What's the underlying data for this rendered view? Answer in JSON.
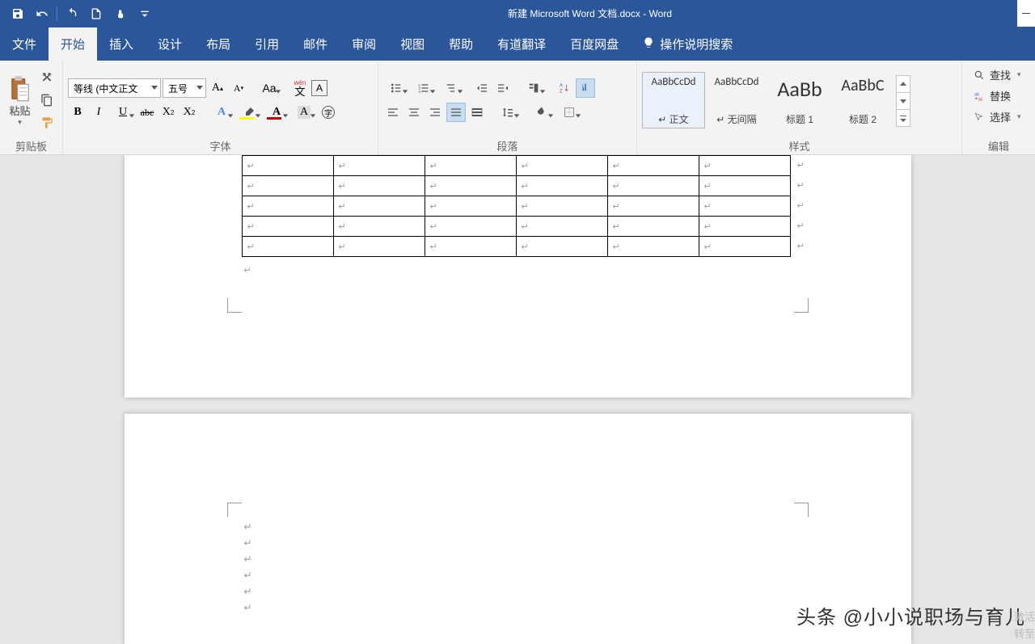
{
  "title": "新建 Microsoft Word 文档.docx - Word",
  "tabs": {
    "file": "文件",
    "home": "开始",
    "insert": "插入",
    "design": "设计",
    "layout": "布局",
    "references": "引用",
    "mail": "邮件",
    "review": "审阅",
    "view": "视图",
    "help": "帮助",
    "youdao": "有道翻译",
    "baidu": "百度网盘",
    "tell": "操作说明搜索"
  },
  "groups": {
    "clipboard": "剪贴板",
    "font": "字体",
    "paragraph": "段落",
    "styles": "样式",
    "editing": "编辑",
    "paste": "粘贴"
  },
  "font": {
    "name": "等线 (中文正文",
    "size": "五号",
    "wen": "wén",
    "aa": "Aa",
    "a_char": "A"
  },
  "styles": {
    "normal": {
      "preview": "AaBbCcDd",
      "name": "↵ 正文"
    },
    "nospace": {
      "preview": "AaBbCcDd",
      "name": "↵ 无间隔"
    },
    "h1": {
      "preview": "AaBb",
      "name": "标题 1"
    },
    "h2": {
      "preview": "AaBbC",
      "name": "标题 2"
    }
  },
  "editing": {
    "find": "查找",
    "replace": "替换",
    "select": "选择"
  },
  "table": {
    "rows": 5,
    "cols": 6
  },
  "watermark": "头条 @小小说职场与育儿",
  "activation": {
    "line1": "激活",
    "line2": "转至"
  }
}
